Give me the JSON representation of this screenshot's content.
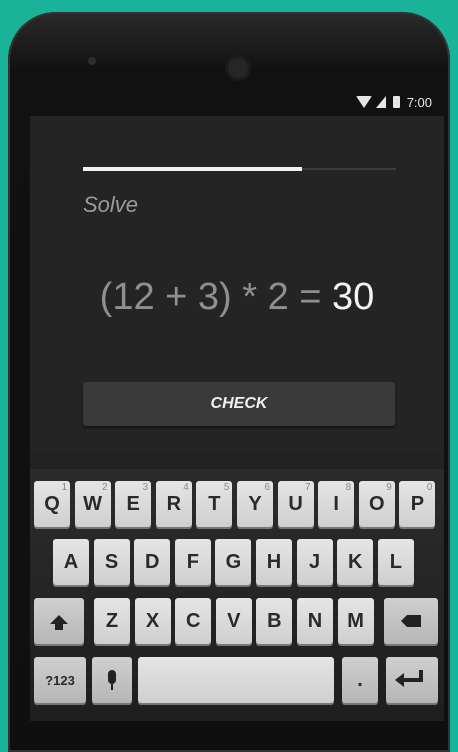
{
  "status_bar": {
    "time": "7:00"
  },
  "quiz": {
    "progress": 0.7,
    "prompt": "Solve",
    "expression": "(12 + 3) * 2 = ",
    "answer": "30",
    "check_label": "CHECK"
  },
  "keyboard": {
    "row1": [
      {
        "label": "Q",
        "hint": "1"
      },
      {
        "label": "W",
        "hint": "2"
      },
      {
        "label": "E",
        "hint": "3"
      },
      {
        "label": "R",
        "hint": "4"
      },
      {
        "label": "T",
        "hint": "5"
      },
      {
        "label": "Y",
        "hint": "6"
      },
      {
        "label": "U",
        "hint": "7"
      },
      {
        "label": "I",
        "hint": "8"
      },
      {
        "label": "O",
        "hint": "9"
      },
      {
        "label": "P",
        "hint": "0"
      }
    ],
    "row2": [
      "A",
      "S",
      "D",
      "F",
      "G",
      "H",
      "J",
      "K",
      "L"
    ],
    "row3": [
      "Z",
      "X",
      "C",
      "V",
      "B",
      "N",
      "M"
    ],
    "symbols_label": "?123",
    "period_label": "."
  },
  "colors": {
    "background": "#19b39a",
    "screen": "#242424",
    "key": "#d9d9d9"
  },
  "icons": [
    "wifi-icon",
    "signal-icon",
    "battery-icon",
    "shift-icon",
    "backspace-icon",
    "mic-icon",
    "enter-icon"
  ]
}
